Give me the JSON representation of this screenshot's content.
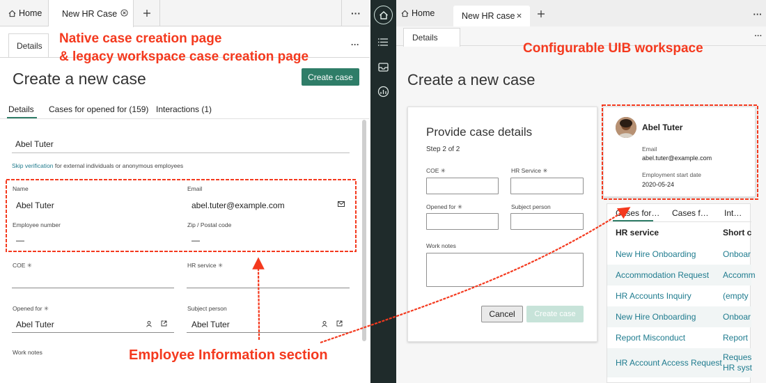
{
  "left": {
    "tabs": {
      "home": "Home",
      "new_case": "New HR Case"
    },
    "subtab": "Details",
    "page_title": "Create a new case",
    "create_button": "Create case",
    "record_tabs": [
      "Details",
      "Cases for opened for (159)",
      "Interactions (1)"
    ],
    "search_value": "Abel Tuter",
    "skip_link": "Skip verification",
    "skip_text": " for external individuals or anonymous employees",
    "employee_info": {
      "name_label": "Name",
      "name_value": "Abel Tuter",
      "email_label": "Email",
      "email_value": "abel.tuter@example.com",
      "empnum_label": "Employee number",
      "empnum_value": "—",
      "zip_label": "Zip / Postal code",
      "zip_value": "—"
    },
    "coe_label": "COE",
    "hr_service_label": "HR service",
    "opened_for_label": "Opened for",
    "opened_for_value": "Abel Tuter",
    "subject_person_label": "Subject person",
    "subject_person_value": "Abel Tuter",
    "work_notes_label": "Work notes",
    "required_mark": "✳"
  },
  "right": {
    "tabs": {
      "home": "Home",
      "new_case": "New HR case"
    },
    "subtab": "Details",
    "page_title": "Create a new case",
    "form": {
      "heading": "Provide case details",
      "step": "Step 2 of 2",
      "coe_label": "COE",
      "hr_service_label": "HR Service",
      "opened_for_label": "Opened for",
      "subject_person_label": "Subject person",
      "work_notes_label": "Work notes",
      "cancel_button": "Cancel",
      "create_button": "Create case"
    },
    "profile": {
      "name": "Abel Tuter",
      "email_label": "Email",
      "email_value": "abel.tuter@example.com",
      "start_label": "Employment start date",
      "start_value": "2020-05-24"
    },
    "related_tabs": [
      "Cases for…",
      "Cases f…",
      "Int…"
    ],
    "table": {
      "headers": [
        "HR service",
        "Short c"
      ],
      "rows": [
        {
          "service": "New Hire Onboarding",
          "short": "Onboar"
        },
        {
          "service": "Accommodation Request",
          "short": "Accomm"
        },
        {
          "service": "HR Accounts Inquiry",
          "short": "(empty"
        },
        {
          "service": "New Hire Onboarding",
          "short": "Onboar"
        },
        {
          "service": "Report Misconduct",
          "short": "Report"
        },
        {
          "service": "HR Account Access Request",
          "short": "Reques",
          "short2": "HR syst"
        }
      ]
    }
  },
  "annotations": {
    "native_line1": "Native case creation page",
    "native_line2": "& legacy workspace case creation page",
    "uib": "Configurable UIB workspace",
    "employee_section": "Employee Information section"
  },
  "colors": {
    "accent_green": "#2f7d68",
    "annotation_red": "#f4391e",
    "rail_dark": "#1f2b2b",
    "link_teal": "#1e7b8e"
  }
}
